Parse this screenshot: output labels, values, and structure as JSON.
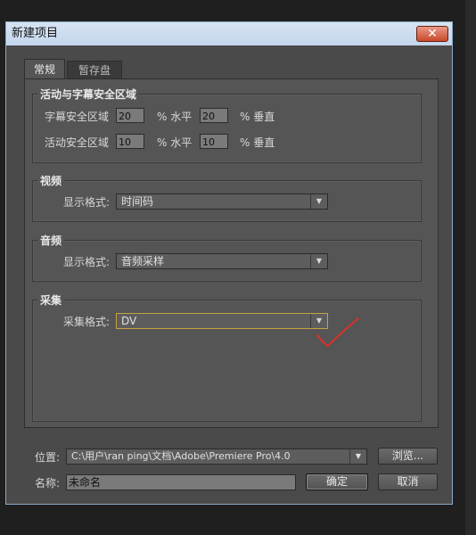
{
  "dialog": {
    "title": "新建项目",
    "close_glyph": "✕"
  },
  "tabs": [
    {
      "label": "常规",
      "active": true
    },
    {
      "label": "暂存盘",
      "active": false
    }
  ],
  "safe_area": {
    "legend": "活动与字幕安全区域",
    "title_safe_label": "字幕安全区域",
    "title_safe_h": "20",
    "title_safe_v": "20",
    "action_safe_label": "活动安全区域",
    "action_safe_h": "10",
    "action_safe_v": "10",
    "pct_horizontal": "% 水平",
    "pct_vertical": "% 垂直"
  },
  "video": {
    "legend": "视频",
    "format_label": "显示格式:",
    "format_value": "时间码"
  },
  "audio": {
    "legend": "音频",
    "format_label": "显示格式:",
    "format_value": "音频采样"
  },
  "capture": {
    "legend": "采集",
    "format_label": "采集格式:",
    "format_value": "DV"
  },
  "footer": {
    "location_label": "位置:",
    "location_value": "C:\\用户\\ran ping\\文档\\Adobe\\Premiere Pro\\4.0",
    "browse_label": "浏览...",
    "name_label": "名称:",
    "name_value": "未命名",
    "ok_label": "确定",
    "cancel_label": "取消"
  },
  "icons": {
    "dropdown": "chevron-down-icon",
    "annotation": "red-checkmark-annotation"
  },
  "colors": {
    "annotation": "#d9302a",
    "focus_border": "#c8a243"
  }
}
